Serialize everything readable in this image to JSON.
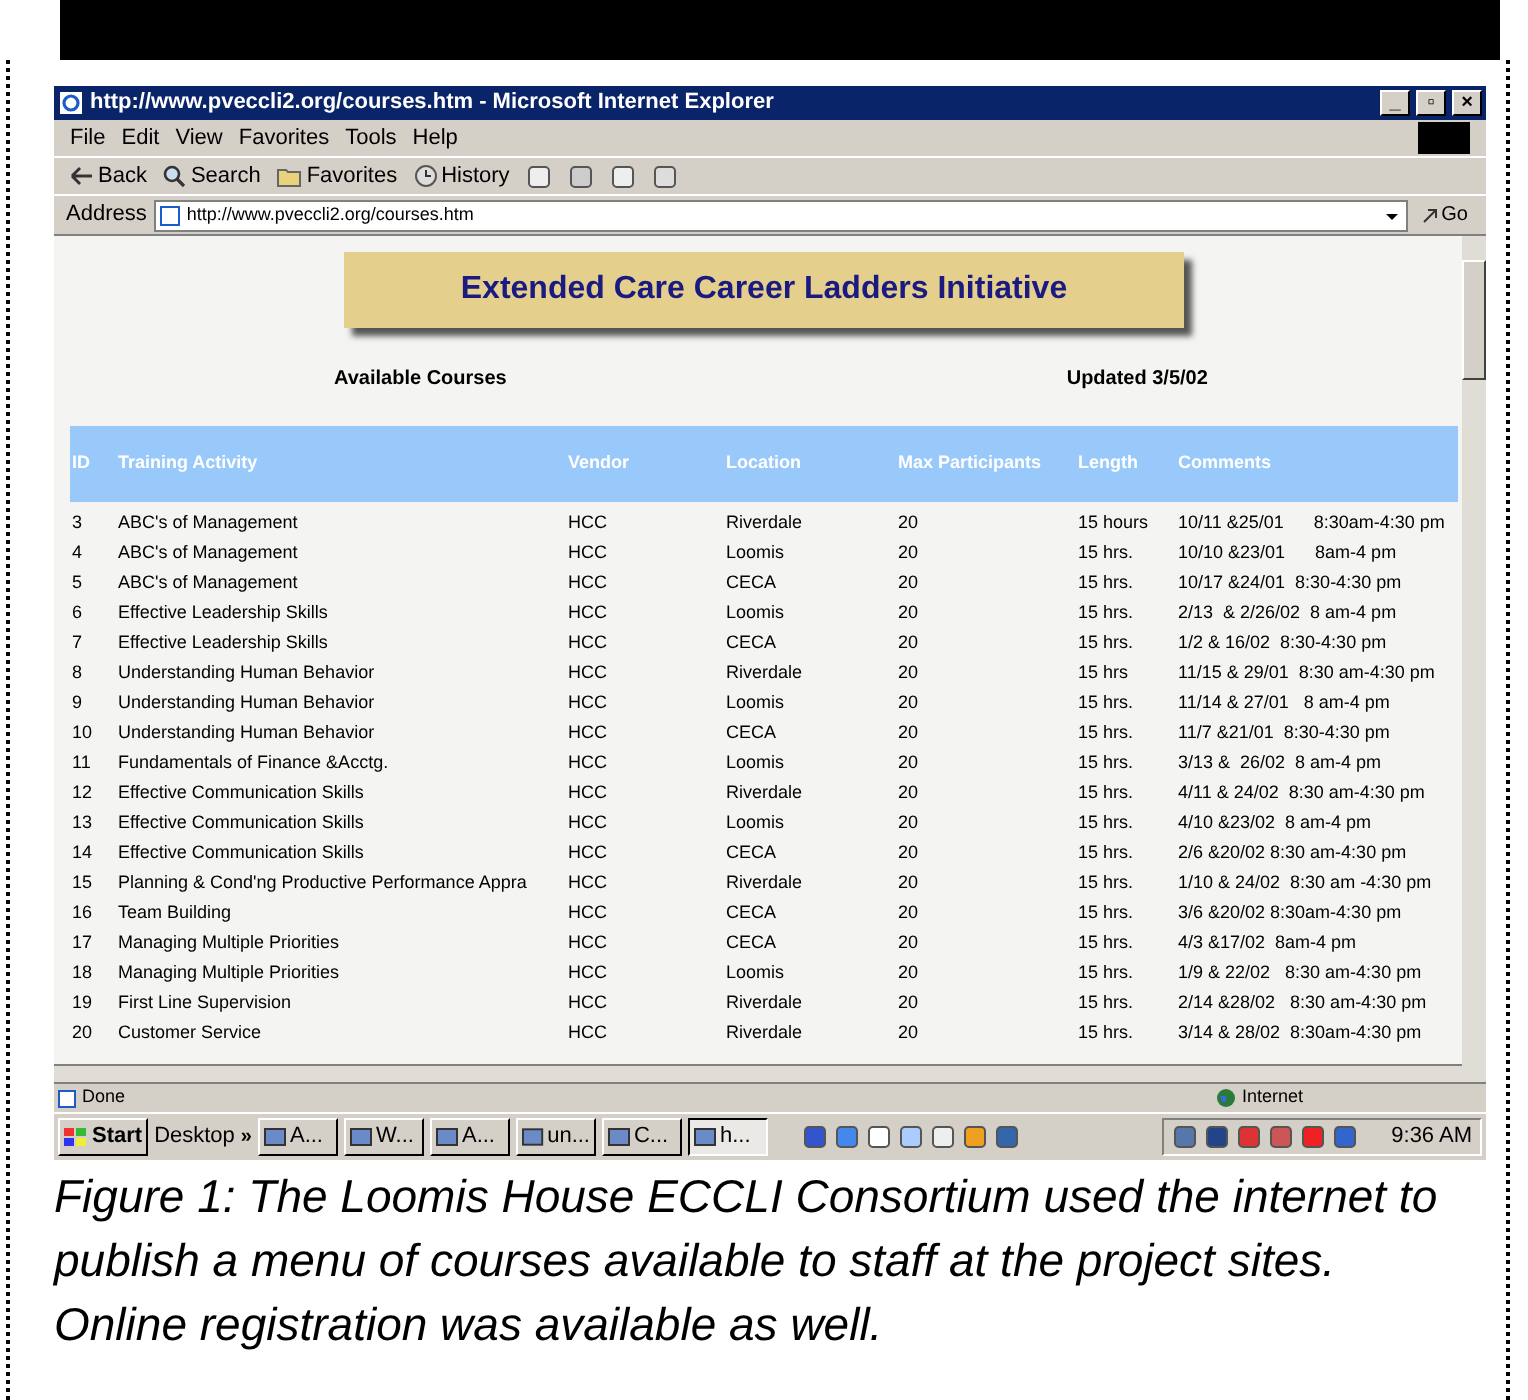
{
  "window": {
    "title": "http://www.pveccli2.org/courses.htm - Microsoft Internet Explorer",
    "controls": [
      "_",
      "▫",
      "×"
    ]
  },
  "menu": [
    "File",
    "Edit",
    "View",
    "Favorites",
    "Tools",
    "Help"
  ],
  "toolbar": [
    {
      "kind": "back",
      "label": "Back"
    },
    {
      "kind": "search",
      "label": "Search"
    },
    {
      "kind": "favorites",
      "label": "Favorites"
    },
    {
      "kind": "history",
      "label": "History"
    }
  ],
  "address": {
    "label": "Address",
    "value": "http://www.pveccli2.org/courses.htm",
    "go": "Go"
  },
  "page": {
    "banner": "Extended Care Career Ladders Initiative",
    "subtitle": "Available Courses",
    "updated": "Updated 3/5/02"
  },
  "table": {
    "columns": [
      "ID",
      "Training Activity",
      "Vendor",
      "Location",
      "Max Participants",
      "Length",
      "Comments"
    ],
    "rows": [
      [
        "3",
        "ABC's of Management",
        "HCC",
        "Riverdale",
        "20",
        "15 hours",
        "10/11 &25/01      8:30am-4:30 pm"
      ],
      [
        "4",
        "ABC's of Management",
        "HCC",
        "Loomis",
        "20",
        "15 hrs.",
        "10/10 &23/01      8am-4 pm"
      ],
      [
        "5",
        "ABC's of Management",
        "HCC",
        "CECA",
        "20",
        "15 hrs.",
        "10/17 &24/01  8:30-4:30 pm"
      ],
      [
        "6",
        "Effective Leadership Skills",
        "HCC",
        "Loomis",
        "20",
        "15 hrs.",
        "2/13  & 2/26/02  8 am-4 pm"
      ],
      [
        "7",
        "Effective Leadership Skills",
        "HCC",
        "CECA",
        "20",
        "15 hrs.",
        "1/2 & 16/02  8:30-4:30 pm"
      ],
      [
        "8",
        "Understanding Human Behavior",
        "HCC",
        "Riverdale",
        "20",
        "15 hrs",
        "11/15 & 29/01  8:30 am-4:30 pm"
      ],
      [
        "9",
        "Understanding Human Behavior",
        "HCC",
        "Loomis",
        "20",
        "15 hrs.",
        "11/14 & 27/01   8 am-4 pm"
      ],
      [
        "10",
        "Understanding Human Behavior",
        "HCC",
        "CECA",
        "20",
        "15 hrs.",
        "11/7 &21/01  8:30-4:30 pm"
      ],
      [
        "11",
        "Fundamentals of Finance &Acctg.",
        "HCC",
        "Loomis",
        "20",
        "15 hrs.",
        "3/13 &  26/02  8 am-4 pm"
      ],
      [
        "12",
        "Effective Communication Skills",
        "HCC",
        "Riverdale",
        "20",
        "15 hrs.",
        "4/11 & 24/02  8:30 am-4:30 pm"
      ],
      [
        "13",
        "Effective Communication Skills",
        "HCC",
        "Loomis",
        "20",
        "15 hrs.",
        "4/10 &23/02  8 am-4 pm"
      ],
      [
        "14",
        "Effective Communication Skills",
        "HCC",
        "CECA",
        "20",
        "15 hrs.",
        "2/6 &20/02 8:30 am-4:30 pm"
      ],
      [
        "15",
        "Planning & Cond'ng Productive Performance Appra",
        "HCC",
        "Riverdale",
        "20",
        "15 hrs.",
        "1/10 & 24/02  8:30 am -4:30 pm"
      ],
      [
        "16",
        "Team Building",
        "HCC",
        "CECA",
        "20",
        "15 hrs.",
        "3/6 &20/02 8:30am-4:30 pm"
      ],
      [
        "17",
        "Managing Multiple Priorities",
        "HCC",
        "CECA",
        "20",
        "15 hrs.",
        "4/3 &17/02  8am-4 pm"
      ],
      [
        "18",
        "Managing Multiple Priorities",
        "HCC",
        "Loomis",
        "20",
        "15 hrs.",
        "1/9 & 22/02   8:30 am-4:30 pm"
      ],
      [
        "19",
        "First Line Supervision",
        "HCC",
        "Riverdale",
        "20",
        "15 hrs.",
        "2/14 &28/02   8:30 am-4:30 pm"
      ],
      [
        "20",
        "Customer Service",
        "HCC",
        "Riverdale",
        "20",
        "15 hrs.",
        "3/14 & 28/02  8:30am-4:30 pm"
      ]
    ]
  },
  "status": {
    "text": "Done",
    "zone": "Internet"
  },
  "taskbar": {
    "start": "Start",
    "desktop": "Desktop",
    "more": "»",
    "items": [
      {
        "label": "A...",
        "selected": false
      },
      {
        "label": "W...",
        "selected": false
      },
      {
        "label": "A...",
        "selected": false
      },
      {
        "label": "un...",
        "selected": false
      },
      {
        "label": "C...",
        "selected": false
      },
      {
        "label": "h...",
        "selected": true
      }
    ],
    "clock": "9:36 AM"
  },
  "caption": "Figure 1: The Loomis House ECCLI Consortium used the internet to publish a menu of courses available to staff at the project sites.  Online registration was available as well."
}
